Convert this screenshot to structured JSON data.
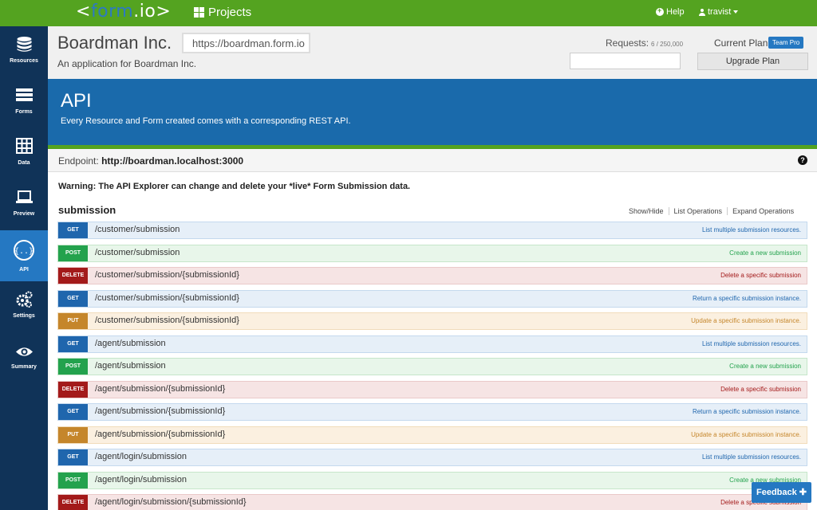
{
  "navbar": {
    "logo": {
      "open": "<",
      "form": "form",
      "dot": ".",
      "io": "io",
      "close": ">"
    },
    "projects_label": "Projects",
    "help_label": "Help",
    "user_label": "travist"
  },
  "sidebar": {
    "items": [
      {
        "label": "Resources",
        "icon": "database-icon"
      },
      {
        "label": "Forms",
        "icon": "forms-icon"
      },
      {
        "label": "Data",
        "icon": "table-icon"
      },
      {
        "label": "Preview",
        "icon": "laptop-icon"
      },
      {
        "label": "API",
        "icon": "api-icon",
        "active": true
      },
      {
        "label": "Settings",
        "icon": "gears-icon"
      },
      {
        "label": "Summary",
        "icon": "eye-icon"
      }
    ]
  },
  "project": {
    "name": "Boardman Inc.",
    "url": "https://boardman.form.io",
    "description": "An application for Boardman Inc.",
    "requests_label": "Requests:",
    "requests_count": "6 / 250,000",
    "plan_label": "Current Plan:",
    "plan_badge": "Team Pro",
    "upgrade_label": "Upgrade Plan"
  },
  "banner": {
    "title": "API",
    "subtitle": "Every Resource and Form created comes with a corresponding REST API."
  },
  "endpoint": {
    "label": "Endpoint:",
    "value": "http://boardman.localhost:3000"
  },
  "warning": "Warning: The API Explorer can change and delete your *live* Form Submission data.",
  "section": {
    "title": "submission",
    "links": [
      "Show/Hide",
      "List Operations",
      "Expand Operations"
    ]
  },
  "operations": [
    {
      "method": "GET",
      "path": "/customer/submission",
      "desc": "List multiple submission resources."
    },
    {
      "method": "POST",
      "path": "/customer/submission",
      "desc": "Create a new submission"
    },
    {
      "method": "DELETE",
      "path": "/customer/submission/{submissionId}",
      "desc": "Delete a specific submission"
    },
    {
      "method": "GET",
      "path": "/customer/submission/{submissionId}",
      "desc": "Return a specific submission instance."
    },
    {
      "method": "PUT",
      "path": "/customer/submission/{submissionId}",
      "desc": "Update a specific submission instance."
    },
    {
      "method": "GET",
      "path": "/agent/submission",
      "desc": "List multiple submission resources."
    },
    {
      "method": "POST",
      "path": "/agent/submission",
      "desc": "Create a new submission"
    },
    {
      "method": "DELETE",
      "path": "/agent/submission/{submissionId}",
      "desc": "Delete a specific submission"
    },
    {
      "method": "GET",
      "path": "/agent/submission/{submissionId}",
      "desc": "Return a specific submission instance."
    },
    {
      "method": "PUT",
      "path": "/agent/submission/{submissionId}",
      "desc": "Update a specific submission instance."
    },
    {
      "method": "GET",
      "path": "/agent/login/submission",
      "desc": "List multiple submission resources."
    },
    {
      "method": "POST",
      "path": "/agent/login/submission",
      "desc": "Create a new submission"
    },
    {
      "method": "DELETE",
      "path": "/agent/login/submission/{submissionId}",
      "desc": "Delete a specific submission"
    }
  ],
  "feedback_label": "Feedback",
  "colors": {
    "navbar": "#54a320",
    "sidebar": "#103358",
    "sidebar_active": "#2578c2",
    "banner": "#1a6aab",
    "get": "#1f66ad",
    "post": "#23a24d",
    "delete": "#a31a1a",
    "put": "#c5862b"
  }
}
